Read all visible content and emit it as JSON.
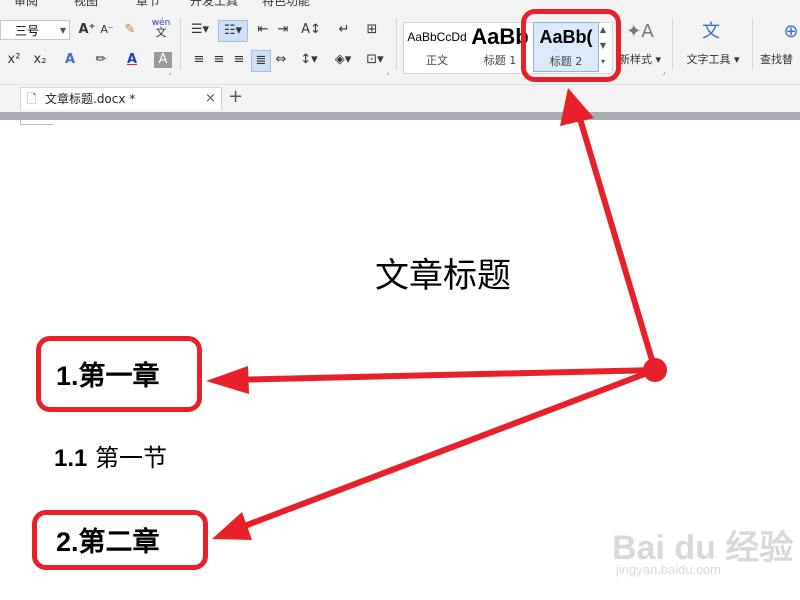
{
  "menu": {
    "items": [
      "审阅",
      "视图",
      "章节",
      "开发工具",
      "特色功能"
    ]
  },
  "font_toolbar": {
    "font_size": "三号",
    "grow_font": "A⁺",
    "shrink_font": "A⁻",
    "pinyin_top": "wén",
    "pinyin_bottom": "文",
    "superscript": "x²",
    "subscript": "x₂"
  },
  "styles": {
    "items": [
      {
        "sample": "AaBbCcDd",
        "label": "正文"
      },
      {
        "sample": "AaBb",
        "label": "标题 1"
      },
      {
        "sample": "AaBb(",
        "label": "标题 2"
      }
    ],
    "new_style_label": "新样式",
    "text_tools_label": "文字工具",
    "find_replace_label": "查找替"
  },
  "tabs": {
    "doc_tab_label": "文章标题.docx *",
    "close_glyph": "×",
    "add_glyph": "+"
  },
  "document": {
    "title": "文章标题",
    "h1_chapter1": "1.第一章",
    "h2_section1_num": "1.1",
    "h2_section1_text": "第一节",
    "h1_chapter2": "2.第二章"
  },
  "watermark": {
    "brand": "Bai du 经验",
    "url": "jingyan.baidu.com"
  },
  "colors": {
    "annotation_red": "#e8202a",
    "ribbon_bg": "#f3f3f3",
    "font_color_accent": "#1f3fbf"
  }
}
